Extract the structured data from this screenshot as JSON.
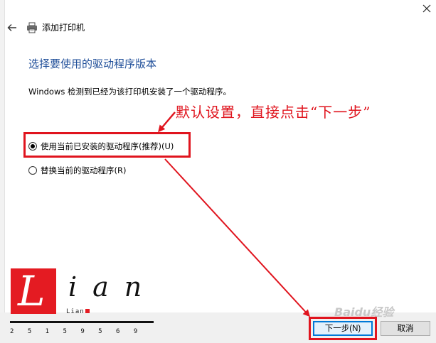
{
  "window": {
    "title": "添加打印机"
  },
  "page": {
    "heading": "选择要使用的驱动程序版本",
    "description": "Windows 检测到已经为该打印机安装了一个驱动程序。"
  },
  "options": [
    {
      "label": "使用当前已安装的驱动程序(推荐)(U)",
      "selected": true
    },
    {
      "label": "替换当前的驱动程序(R)",
      "selected": false
    }
  ],
  "buttons": {
    "next": "下一步(N)",
    "cancel": "取消"
  },
  "annotation": {
    "text": "默认设置，直接点击“下一步”",
    "color": "#e0141e"
  },
  "logo": {
    "initial": "L",
    "letters": "ian",
    "small_text": "Lian",
    "digits": "2 5 1 5 9 5 6 9",
    "brand_color": "#e41b22"
  },
  "watermark": "Baidu经验",
  "colors": {
    "heading": "#1f4e99",
    "primary_button_border": "#0078d7",
    "footer_bg": "#f0f0f0"
  }
}
